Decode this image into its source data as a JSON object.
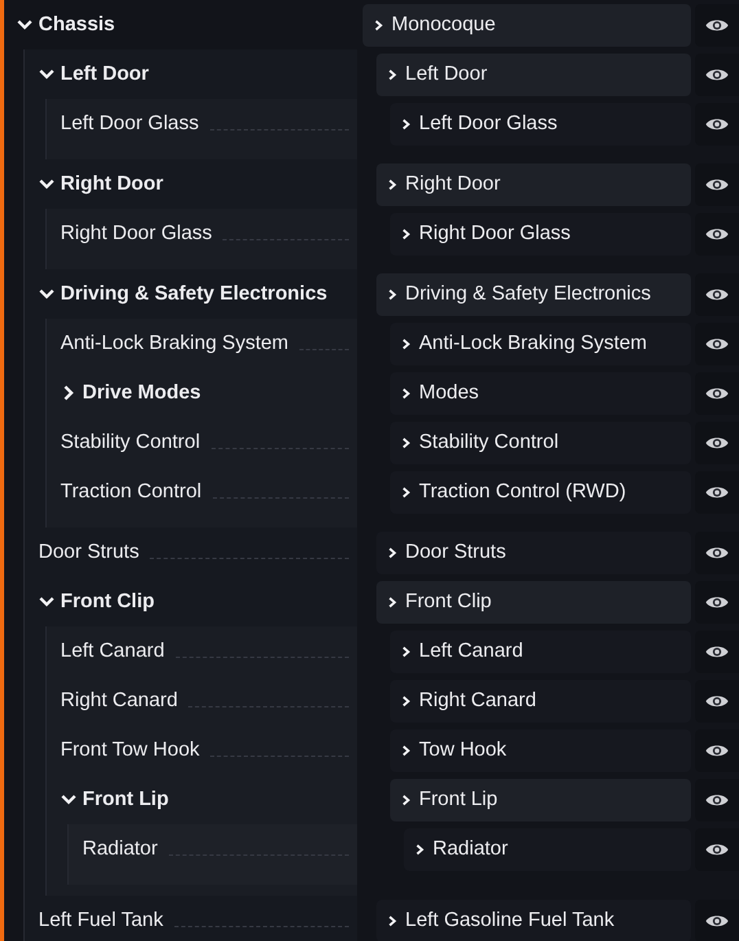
{
  "tree": [
    {
      "label": "Chassis",
      "part": "Monocoque",
      "expanded": true,
      "children": [
        {
          "label": "Left Door",
          "part": "Left Door",
          "expanded": true,
          "children": [
            {
              "label": "Left Door Glass",
              "part": "Left Door Glass"
            }
          ]
        },
        {
          "label": "Right Door",
          "part": "Right Door",
          "expanded": true,
          "children": [
            {
              "label": "Right Door Glass",
              "part": "Right Door Glass"
            }
          ]
        },
        {
          "label": "Driving & Safety Electronics",
          "part": "Driving & Safety Electronics",
          "expanded": true,
          "children": [
            {
              "label": "Anti-Lock Braking System",
              "part": "Anti-Lock Braking System"
            },
            {
              "label": "Drive Modes",
              "part": "Modes",
              "expanded": false
            },
            {
              "label": "Stability Control",
              "part": "Stability Control"
            },
            {
              "label": "Traction Control",
              "part": "Traction Control (RWD)"
            }
          ]
        },
        {
          "label": "Door Struts",
          "part": "Door Struts"
        },
        {
          "label": "Front Clip",
          "part": "Front Clip",
          "expanded": true,
          "children": [
            {
              "label": "Left Canard",
              "part": "Left Canard"
            },
            {
              "label": "Right Canard",
              "part": "Right Canard"
            },
            {
              "label": "Front Tow Hook",
              "part": "Tow Hook"
            },
            {
              "label": "Front Lip",
              "part": "Front Lip",
              "expanded": true,
              "children": [
                {
                  "label": "Radiator",
                  "part": "Radiator"
                }
              ]
            }
          ]
        },
        {
          "label": "Left Fuel Tank",
          "part": "Left Gasoline Fuel Tank"
        }
      ]
    }
  ]
}
